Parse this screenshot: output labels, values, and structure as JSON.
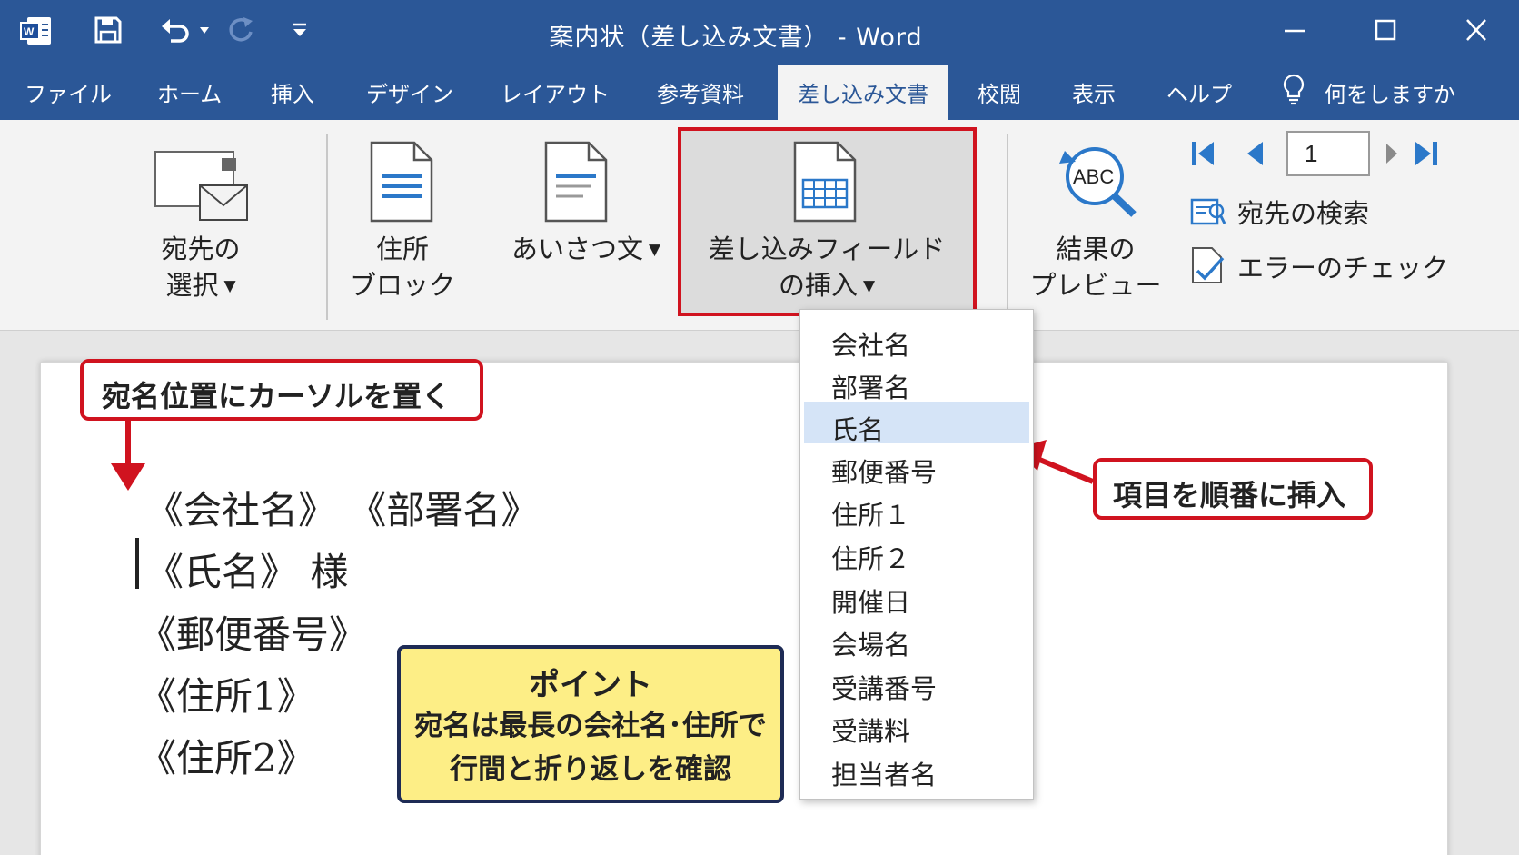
{
  "window": {
    "title": "案内状（差し込み文書） - Word"
  },
  "menu": {
    "tabs": [
      "ファイル",
      "ホーム",
      "挿入",
      "デザイン",
      "レイアウト",
      "参考資料",
      "差し込み文書",
      "校閲",
      "表示",
      "ヘルプ"
    ],
    "active_tab": "差し込み文書",
    "tell_me": "何をしますか"
  },
  "ribbon": {
    "select_recipients": {
      "line1": "宛先の",
      "line2": "選択"
    },
    "address_block": {
      "line1": "住所",
      "line2": "ブロック"
    },
    "greeting_line": "あいさつ文",
    "insert_merge_field": {
      "line1": "差し込みフィールド",
      "line2": "の挿入"
    },
    "preview_results": {
      "line1": "結果の",
      "line2": "プレビュー",
      "icon_text": "ABC"
    },
    "record_number": "1",
    "find_recipient": "宛先の検索",
    "check_errors": "エラーのチェック"
  },
  "dropdown": {
    "items": [
      "会社名",
      "部署名",
      "氏名",
      "郵便番号",
      "住所１",
      "住所２",
      "開催日",
      "会場名",
      "受講番号",
      "受講料",
      "担当者名"
    ],
    "selected": "氏名"
  },
  "document": {
    "lines": [
      "《会社名》 《部署名》",
      "《氏名》 様",
      "《郵便番号》",
      "《住所1》",
      "《住所2》"
    ]
  },
  "callouts": {
    "cursor_note": "宛名位置にカーソルを置く",
    "insert_note": "項目を順番に挿入",
    "point": {
      "title": "ポイント",
      "line1": "宛名は最長の会社名･住所で",
      "line2": "行間と折り返しを確認"
    }
  },
  "colors": {
    "titlebar": "#2b5797",
    "accent_red": "#d0131f",
    "point_bg": "#fdee86",
    "selected_item": "#d5e4f7"
  }
}
